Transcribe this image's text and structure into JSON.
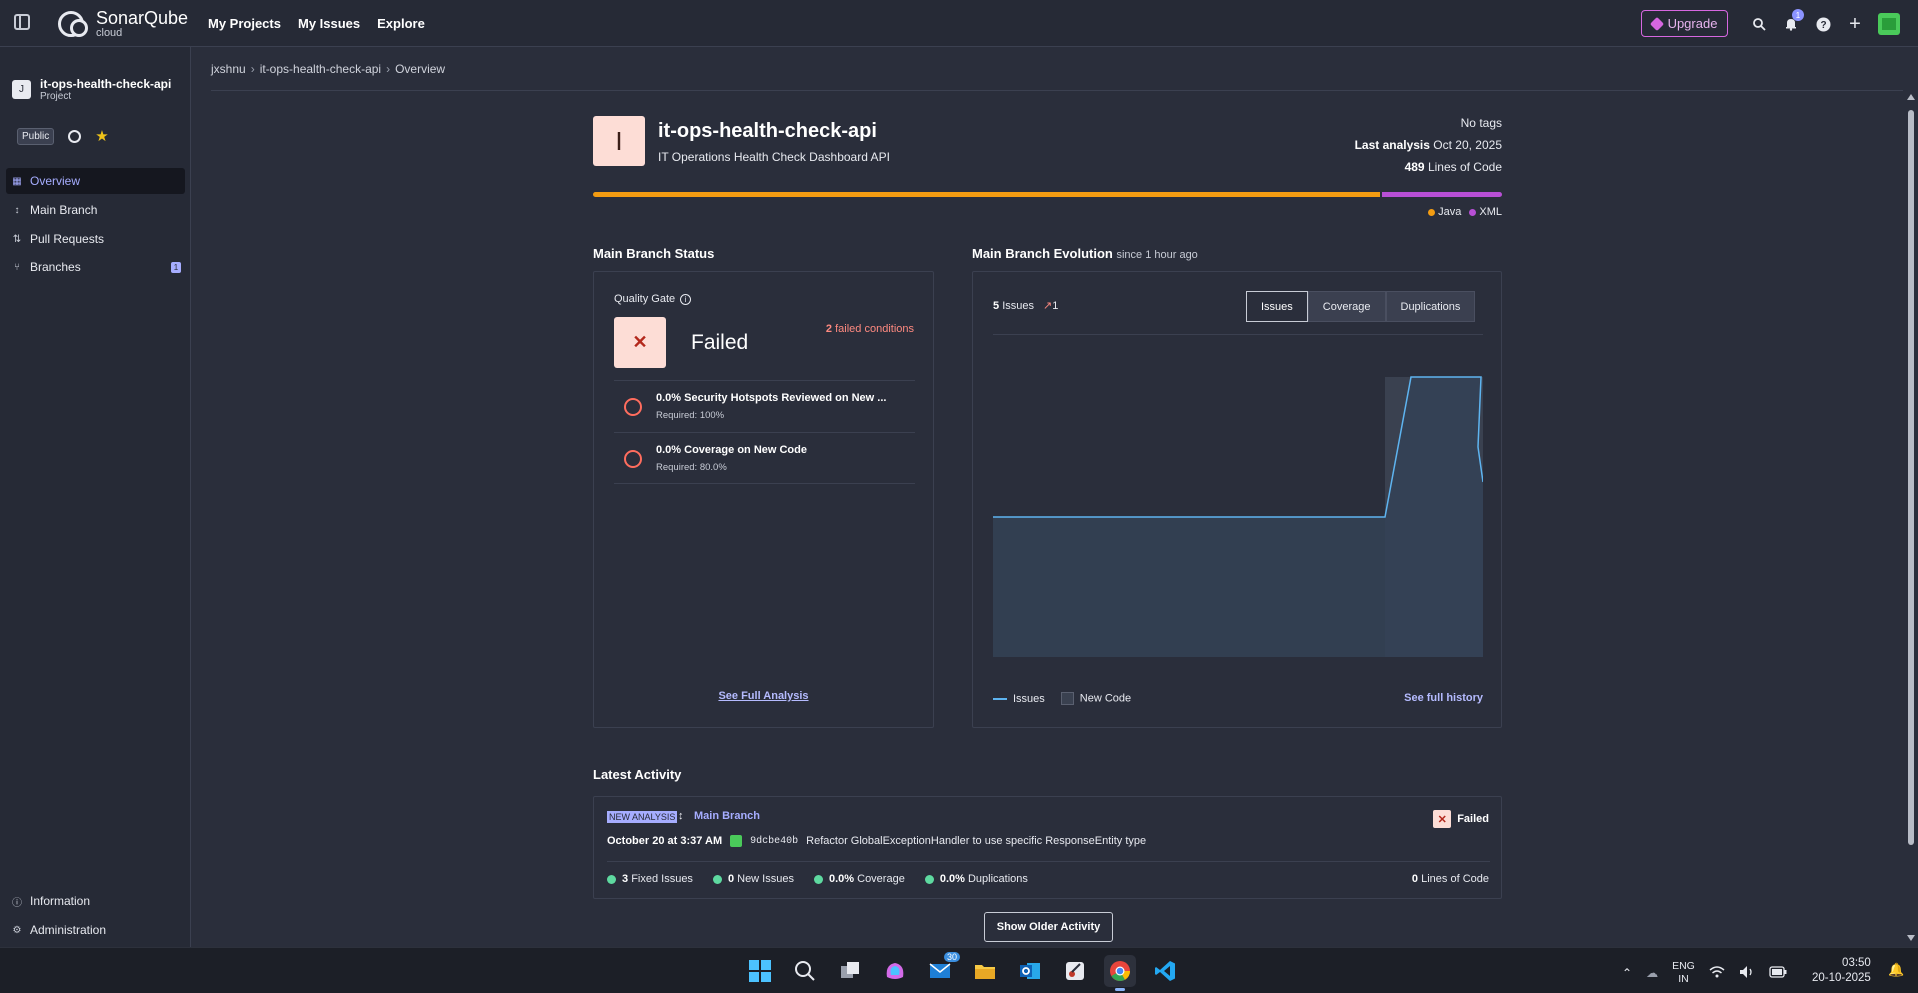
{
  "topbar": {
    "logo_name": "SonarQube",
    "logo_sub": "cloud",
    "nav": [
      "My Projects",
      "My Issues",
      "Explore"
    ],
    "upgrade_label": "Upgrade",
    "notification_count": "1"
  },
  "sidebar": {
    "project_initial": "J",
    "project_name": "it-ops-health-check-api",
    "project_type": "Project",
    "visibility": "Public",
    "items": [
      {
        "label": "Overview",
        "icon": "grid-icon",
        "active": true
      },
      {
        "label": "Main Branch",
        "icon": "branch-icon"
      },
      {
        "label": "Pull Requests",
        "icon": "pull-request-icon"
      },
      {
        "label": "Branches",
        "icon": "branches-icon",
        "badge": "1"
      }
    ],
    "bottom_items": [
      {
        "label": "Information",
        "icon": "info-icon"
      },
      {
        "label": "Administration",
        "icon": "gear-icon"
      }
    ]
  },
  "breadcrumb": [
    "jxshnu",
    "it-ops-health-check-api",
    "Overview"
  ],
  "project": {
    "initial": "I",
    "title": "it-ops-health-check-api",
    "description": "IT Operations Health Check Dashboard API",
    "tags": "No tags",
    "last_analysis_label": "Last analysis",
    "last_analysis_date": "Oct 20, 2025",
    "loc_value": "489",
    "loc_label": "Lines of Code",
    "languages": [
      {
        "name": "Java",
        "color": "#f39c12",
        "share": 0.868
      },
      {
        "name": "XML",
        "color": "#b84fd6",
        "share": 0.132
      }
    ]
  },
  "branch_status": {
    "title": "Main Branch Status",
    "qg_label": "Quality Gate",
    "status": "Failed",
    "failed_count": "2",
    "failed_label": "failed conditions",
    "conditions": [
      {
        "title": "0.0% Security Hotspots Reviewed on New ...",
        "required": "Required: 100%"
      },
      {
        "title": "0.0% Coverage on New Code",
        "required": "Required: 80.0%"
      }
    ],
    "see_full": "See Full Analysis"
  },
  "evolution": {
    "title": "Main Branch Evolution",
    "since": "since 1 hour ago",
    "issues_value": "5",
    "issues_label": "Issues",
    "issues_delta": "1",
    "tabs": [
      "Issues",
      "Coverage",
      "Duplications"
    ],
    "active_tab": "Issues",
    "legend_issues": "Issues",
    "legend_new_code": "New Code",
    "see_history": "See full history",
    "colors": {
      "line": "#5eb4f0",
      "area": "#344256",
      "new_code": "#3a4150"
    }
  },
  "chart_data": {
    "type": "area",
    "series": [
      {
        "values": [
          4,
          4,
          4,
          4,
          4,
          4,
          4,
          4,
          4,
          8,
          8,
          8,
          6,
          5
        ]
      }
    ],
    "new_code_start": 0.8,
    "grid": false
  },
  "activity": {
    "title": "Latest Activity",
    "tag": "NEW ANALYSIS",
    "branch": "Main Branch",
    "status": "Failed",
    "date": "October 20 at 3:37 AM",
    "hash": "9dcbe40b",
    "message": "Refactor GlobalExceptionHandler to use specific ResponseEntity type",
    "stats": [
      {
        "value": "3",
        "label": "Fixed Issues"
      },
      {
        "value": "0",
        "label": "New Issues"
      },
      {
        "value": "0.0%",
        "label": "Coverage"
      },
      {
        "value": "0.0%",
        "label": "Duplications"
      }
    ],
    "loc_value": "0",
    "loc_label": "Lines of Code",
    "older_button": "Show Older Activity"
  },
  "taskbar": {
    "mail_badge": "30",
    "lang_top": "ENG",
    "lang_bottom": "IN",
    "time": "03:50",
    "date": "20-10-2025"
  }
}
